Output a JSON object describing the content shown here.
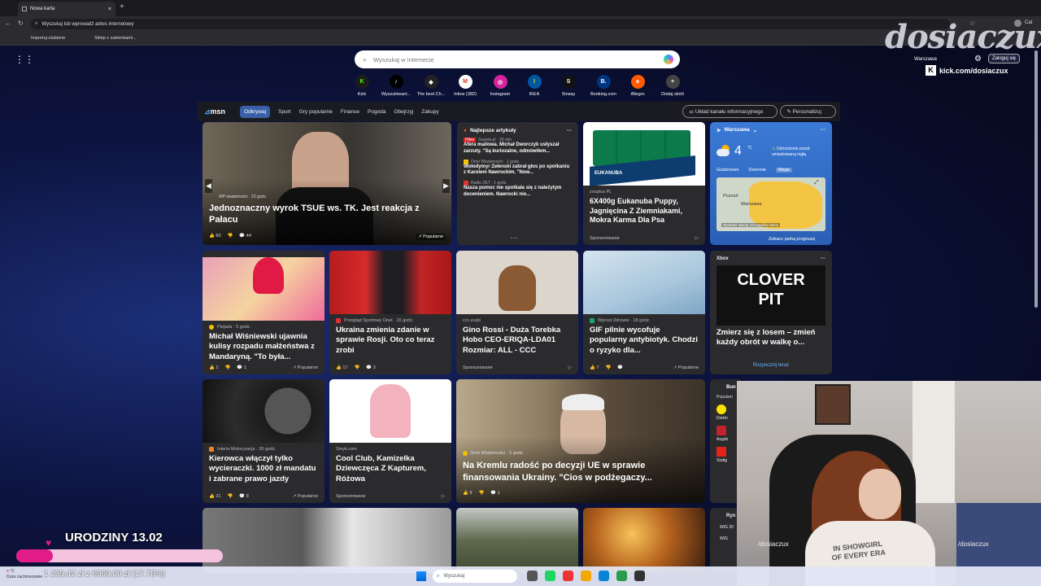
{
  "browser": {
    "tab_title": "Nowa karta",
    "url_placeholder": "Wyszukaj lub wprowadź adres internetowy",
    "bookmarks": [
      "Importuj ulubione",
      "Sklep z sukienkami..."
    ],
    "profile_action": "Cat"
  },
  "ntp": {
    "search_placeholder": "Wyszukaj w Internecie",
    "shortcuts": [
      {
        "label": "Kick",
        "color": "#1c1c1c",
        "glyph": "K",
        "fg": "#53fc18"
      },
      {
        "label": "Wyszukiwani...",
        "color": "#000000",
        "glyph": "♪",
        "fg": "#ffffff"
      },
      {
        "label": "The best Ch...",
        "color": "#222222",
        "glyph": "◆",
        "fg": "#ffffff"
      },
      {
        "label": "Inbox (382)",
        "color": "#ffffff",
        "glyph": "M",
        "fg": "#d93025"
      },
      {
        "label": "Instagram",
        "color": "#d6249f",
        "glyph": "◎",
        "fg": "#ffffff"
      },
      {
        "label": "IKEA",
        "color": "#0058a3",
        "glyph": "I",
        "fg": "#ffdb00"
      },
      {
        "label": "Sinsay",
        "color": "#111111",
        "glyph": "S",
        "fg": "#ffffff"
      },
      {
        "label": "Booking.com",
        "color": "#003580",
        "glyph": "B.",
        "fg": "#ffffff"
      },
      {
        "label": "Allegro",
        "color": "#ff5a00",
        "glyph": "a",
        "fg": "#ffffff"
      },
      {
        "label": "Dodaj skrót",
        "color": "#444444",
        "glyph": "+",
        "fg": "#ffffff"
      }
    ],
    "location": "Warszawa",
    "login": "Zaloguj się"
  },
  "msn": {
    "logo": "msn",
    "nav": [
      "Odkrywaj",
      "Sport",
      "Gry popularne",
      "Finanse",
      "Pogoda",
      "Obejrzyj",
      "Zakupy"
    ],
    "layout_btn": "Układ kanału informacyjnego",
    "personalize_btn": "Personalizuj",
    "hero": {
      "source": "WP wiadomości · 23 godz.",
      "title": "Jednoznaczny wyrok TSUE ws. TK. Jest reakcja z Pałacu",
      "likes": "60",
      "comments": "44",
      "badge": "Popularne"
    },
    "best": {
      "header": "Najlepsze artykuły",
      "items": [
        {
          "tag": "Pilne",
          "source": "Gazeta.pl · 25 min",
          "title": "Afera mailowa. Michał Dworczyk usłyszał zarzuty. \"Są kuriozalne, odmówiłem..."
        },
        {
          "source": "Onet Wiadomości · 1 godz.",
          "title": "Wołodymyr Zełenski zabrał głos po spotkaniu z Karolem Nawrockim. \"Now..."
        },
        {
          "source": "Radio ZET · 1 godz.",
          "title": "Nasza pomoc nie spotkała się z należytym docenieniem. Nawrocki nie..."
        }
      ]
    },
    "ad1": {
      "source": "zooplus PL",
      "title": "6X400g Eukanuba Puppy, Jagnięcina Z Ziemniakami, Mokra Karma Dla Psa",
      "sponsored": "Sponsorowane",
      "brand": "EUKANUBA"
    },
    "weather": {
      "city": "Warszawa",
      "temp": "4",
      "unit": "°C",
      "alert": "Ostrzeżenie przed umiarkowaną mgłą",
      "tabs": [
        "Godzinowo",
        "Dziennie",
        "Mapa"
      ],
      "map_labels": [
        "Poznań",
        "Warszawa"
      ],
      "alerts_link": "Sprawdź więcej szczegółów alertu",
      "forecast_link": "Zobacz pełną prognozę"
    },
    "row2": [
      {
        "source": "Plejada · 5 godz.",
        "title": "Michał Wiśniewski ujawnia kulisy rozpadu małżeństwa z Mandaryną. \"To była...",
        "likes": "2",
        "comments": "1",
        "badge": "Popularne",
        "dot": "#f2c300"
      },
      {
        "source": "Przegląd Sportowy Onet · 15 godz.",
        "title": "Ukraina zmienia zdanie w sprawie Rosji. Oto co teraz zrobi",
        "likes": "17",
        "comments": "3",
        "dot": "#e03030"
      },
      {
        "source": "ccc.eu/pl",
        "title": "Gino Rossi - Duża Torebka Hobo CEO-ERIQA-LDA01 Rozmiar: ALL - CCC",
        "sponsored": "Sponsorowane"
      },
      {
        "source": "Wprost Zdrowie · 18 godz.",
        "title": "GIF pilnie wycofuje popularny antybiotyk. Chodzi o ryzyko dla...",
        "likes": "7",
        "badge": "Popularne",
        "dot": "#1aa36b"
      }
    ],
    "xbox": {
      "source": "Xbox",
      "game_line1": "CLOVER",
      "game_line2": "PIT",
      "title": "Zmierz się z losem – zmień każdy obrót w walkę o...",
      "cta": "Rozpocznij teraz"
    },
    "row3": [
      {
        "source": "Interia Motoryzacja · 20 godz.",
        "title": "Kierowca włączył tylko wycieraczki. 1000 zł mandatu i zabrane prawo jazdy",
        "likes": "31",
        "comments": "8",
        "badge": "Popularne",
        "dot": "#f08020"
      },
      {
        "source": "Smyk.com",
        "title": "Cool Club, Kamizelka Dziewczęca Z Kapturem, Różowa",
        "sponsored": "Sponsorowane"
      },
      {
        "source": "Onet Wiadomości · 5 godz.",
        "title": "Na Kremlu radość po decyzji UE w sprawie finansowania Ukrainy. \"Cios w podżegaczy...",
        "likes": "9",
        "comments": "1",
        "dot": "#f2c300"
      }
    ],
    "side": {
      "h1": "Bun",
      "h2": "Popularn",
      "teams": [
        "Dortm",
        "Augsb",
        "Stuttg"
      ],
      "h3": "Ryn",
      "wig": [
        "WIG 20",
        "WIG"
      ]
    }
  },
  "taskbar": {
    "search": "Wyszukaj",
    "weather_temp": "°C",
    "weather_label": "Duże zachmurzenie"
  },
  "stream": {
    "watermark": "dosiaczux",
    "kick": "kick.com/dosiaczux",
    "goal_title": "URODZINY 13.02",
    "goal_text": "1 239,42 zł z 6969,00 zł (17.78%)",
    "goal_fraction": 0.1778,
    "cam_socials": [
      "/dosiaczux",
      "/dosiaczux"
    ],
    "shirt_text": [
      "IN SHOWGIRL",
      "OF EVERY ERA"
    ]
  },
  "colors": {
    "accent": "#e21c88",
    "msn_active": "#3a5fa8",
    "brand_kick": "#53fc18"
  }
}
